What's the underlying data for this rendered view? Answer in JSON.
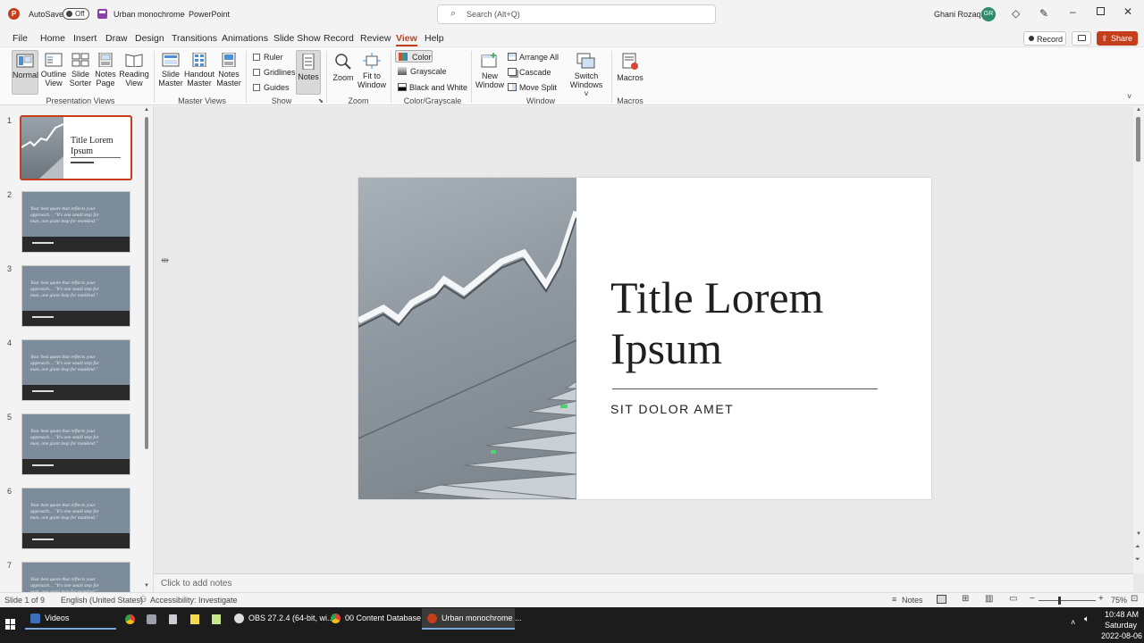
{
  "titlebar": {
    "autosave_label": "AutoSave",
    "autosave_state": "Off",
    "doc_title": "Urban monochrome",
    "app_title": "PowerPoint",
    "search_placeholder": "Search (Alt+Q)",
    "user_name": "Ghani Rozaqi",
    "user_initials": "GR"
  },
  "tabs": [
    "File",
    "Home",
    "Insert",
    "Draw",
    "Design",
    "Transitions",
    "Animations",
    "Slide Show",
    "Record",
    "Review",
    "View",
    "Help"
  ],
  "active_tab": "View",
  "record_label": "Record",
  "share_label": "Share",
  "ribbon": {
    "presentation_views": {
      "label": "Presentation Views",
      "buttons": [
        {
          "l1": "Normal",
          "l2": ""
        },
        {
          "l1": "Outline",
          "l2": "View"
        },
        {
          "l1": "Slide",
          "l2": "Sorter"
        },
        {
          "l1": "Notes",
          "l2": "Page"
        },
        {
          "l1": "Reading",
          "l2": "View"
        }
      ]
    },
    "master_views": {
      "label": "Master Views",
      "buttons": [
        {
          "l1": "Slide",
          "l2": "Master"
        },
        {
          "l1": "Handout",
          "l2": "Master"
        },
        {
          "l1": "Notes",
          "l2": "Master"
        }
      ]
    },
    "show": {
      "label": "Show",
      "ruler": "Ruler",
      "gridlines": "Gridlines",
      "guides": "Guides",
      "notes": "Notes"
    },
    "zoom": {
      "label": "Zoom",
      "zoom": "Zoom",
      "fit_l1": "Fit to",
      "fit_l2": "Window"
    },
    "color": {
      "label": "Color/Grayscale",
      "color": "Color",
      "grayscale": "Grayscale",
      "bw": "Black and White"
    },
    "window": {
      "label": "Window",
      "new_l1": "New",
      "new_l2": "Window",
      "arrange": "Arrange All",
      "cascade": "Cascade",
      "move_split": "Move Split",
      "switch_l1": "Switch",
      "switch_l2": "Windows ˅"
    },
    "macros": {
      "label": "Macros",
      "macros": "Macros"
    }
  },
  "thumbnails": {
    "numbers": [
      "1",
      "2",
      "3",
      "4",
      "5",
      "6",
      "7"
    ],
    "first_title_l1": "Title Lorem",
    "first_title_l2": "Ipsum",
    "quote_l1": "Your best quote that reflects your",
    "quote_l2": "approach… \"It's one small step for",
    "quote_l3": "man, one giant leap for mankind.\""
  },
  "slide": {
    "title_l1": "Title Lorem",
    "title_l2": "Ipsum",
    "subtitle": "SIT DOLOR AMET"
  },
  "notes_placeholder": "Click to add notes",
  "status": {
    "slide_info": "Slide 1 of 9",
    "language": "English (United States)",
    "accessibility": "Accessibility: Investigate",
    "notes": "Notes",
    "zoom_level": "75%"
  },
  "taskbar": {
    "items": [
      "Videos",
      "OBS 27.2.4 (64-bit, wi...",
      "00 Content Database ...",
      "Urban monochrome ..."
    ],
    "time": "10:48 AM",
    "day": "Saturday",
    "date": "2022-08-06"
  },
  "colors": {
    "accent": "#c43e1c",
    "share_bg": "#c43e1c",
    "avatar_bg": "#2e8b6e",
    "taskbar_bg": "#1c1c1c"
  }
}
